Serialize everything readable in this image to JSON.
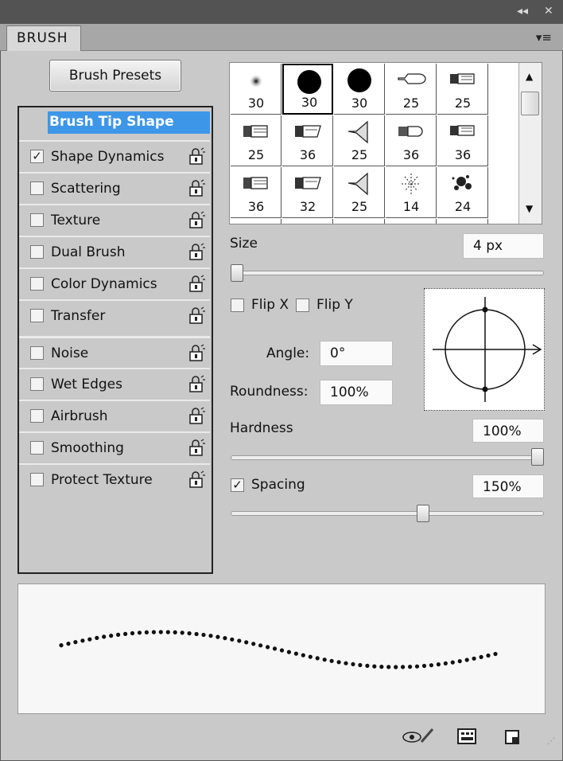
{
  "panel": {
    "tab_title": "BRUSH",
    "collapse_glyph": "◂◂",
    "close_glyph": "✕",
    "menu_glyph": "▾≡"
  },
  "presets_button": "Brush Presets",
  "options": {
    "heading": "Brush Tip Shape",
    "items": [
      {
        "label": "Shape Dynamics",
        "checked": true,
        "lock_icon": "lock-icon"
      },
      {
        "label": "Scattering",
        "checked": false,
        "lock_icon": "lock-icon"
      },
      {
        "label": "Texture",
        "checked": false,
        "lock_icon": "lock-icon"
      },
      {
        "label": "Dual Brush",
        "checked": false,
        "lock_icon": "lock-icon"
      },
      {
        "label": "Color Dynamics",
        "checked": false,
        "lock_icon": "lock-icon"
      },
      {
        "label": "Transfer",
        "checked": false,
        "lock_icon": "lock-icon"
      },
      {
        "label": "Noise",
        "checked": false,
        "lock_icon": "lock-icon"
      },
      {
        "label": "Wet Edges",
        "checked": false,
        "lock_icon": "lock-icon"
      },
      {
        "label": "Airbrush",
        "checked": false,
        "lock_icon": "lock-icon"
      },
      {
        "label": "Smoothing",
        "checked": false,
        "lock_icon": "lock-icon"
      },
      {
        "label": "Protect Texture",
        "checked": false,
        "lock_icon": "lock-icon"
      }
    ]
  },
  "tips": [
    {
      "size": "30",
      "icon": "soft-round-brush-icon"
    },
    {
      "size": "30",
      "icon": "hard-round-brush-icon",
      "selected": true
    },
    {
      "size": "30",
      "icon": "hard-round-brush-icon"
    },
    {
      "size": "25",
      "icon": "pointed-brush-icon"
    },
    {
      "size": "25",
      "icon": "flat-brush-icon"
    },
    {
      "size": "25",
      "icon": "flat-bristle-brush-icon"
    },
    {
      "size": "36",
      "icon": "angled-brush-icon"
    },
    {
      "size": "25",
      "icon": "fan-brush-icon"
    },
    {
      "size": "36",
      "icon": "round-bristle-brush-icon"
    },
    {
      "size": "36",
      "icon": "flat-brush-icon"
    },
    {
      "size": "36",
      "icon": "flat-bristle-brush-icon"
    },
    {
      "size": "32",
      "icon": "angled-brush-icon"
    },
    {
      "size": "25",
      "icon": "fan-brush-icon"
    },
    {
      "size": "14",
      "icon": "sparkle-brush-icon"
    },
    {
      "size": "24",
      "icon": "spatter-brush-icon"
    }
  ],
  "scroll": {
    "up_glyph": "▲",
    "down_glyph": "▼"
  },
  "size": {
    "label": "Size",
    "value": "4 px",
    "slider_fraction": 0.0
  },
  "flip": {
    "x_label": "Flip X",
    "y_label": "Flip Y",
    "x_checked": false,
    "y_checked": false
  },
  "angle": {
    "label": "Angle:",
    "value": "0°"
  },
  "roundness": {
    "label": "Roundness:",
    "value": "100%"
  },
  "hardness": {
    "label": "Hardness",
    "value": "100%",
    "slider_fraction": 1.0
  },
  "spacing": {
    "label": "Spacing",
    "value": "150%",
    "checked": true,
    "check_glyph": "✓",
    "slider_fraction": 0.62
  },
  "check_glyph": "✓",
  "footer_icons": [
    "eye-brush-icon",
    "grid-panel-icon",
    "new-preset-icon"
  ]
}
